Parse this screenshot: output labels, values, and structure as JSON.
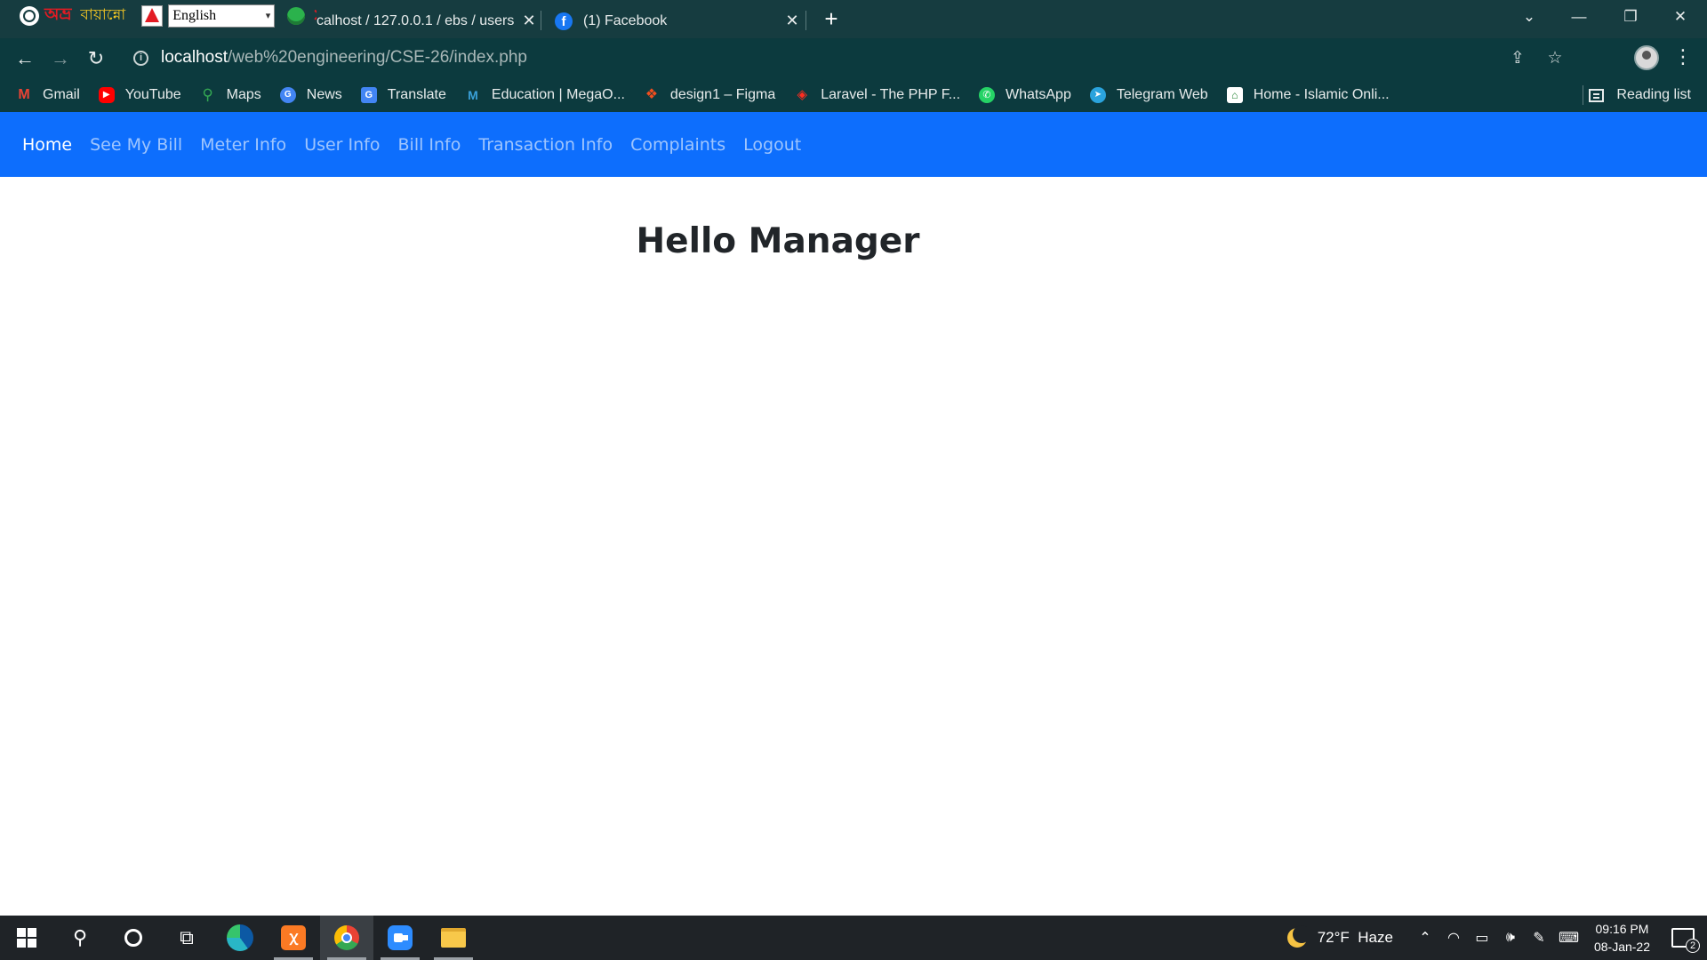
{
  "browser": {
    "avro": {
      "logo": "অভ্র",
      "name": "বায়ান্নো",
      "language": "English"
    },
    "tabs": [
      {
        "title": "calhost / 127.0.0.1 / ebs / users",
        "active": true
      },
      {
        "title": "(1) Facebook",
        "active": false
      }
    ],
    "address": {
      "host": "localhost",
      "path": "/web%20engineering/CSE-26/index.php"
    },
    "bookmarks": [
      {
        "label": "Gmail",
        "icon": "gmail-icon"
      },
      {
        "label": "YouTube",
        "icon": "youtube-icon"
      },
      {
        "label": "Maps",
        "icon": "maps-icon"
      },
      {
        "label": "News",
        "icon": "news-icon"
      },
      {
        "label": "Translate",
        "icon": "translate-icon"
      },
      {
        "label": "Education | MegaO...",
        "icon": "megaoutsource-icon"
      },
      {
        "label": "design1 – Figma",
        "icon": "figma-icon"
      },
      {
        "label": "Laravel - The PHP F...",
        "icon": "laravel-icon"
      },
      {
        "label": "WhatsApp",
        "icon": "whatsapp-icon"
      },
      {
        "label": "Telegram Web",
        "icon": "telegram-icon"
      },
      {
        "label": "Home - Islamic Onli...",
        "icon": "islamic-online-icon"
      }
    ],
    "reading_list": "Reading list"
  },
  "site": {
    "nav": [
      {
        "label": "Home",
        "active": true
      },
      {
        "label": "See My Bill",
        "active": false
      },
      {
        "label": "Meter Info",
        "active": false
      },
      {
        "label": "User Info",
        "active": false
      },
      {
        "label": "Bill Info",
        "active": false
      },
      {
        "label": "Transaction Info",
        "active": false
      },
      {
        "label": "Complaints",
        "active": false
      },
      {
        "label": "Logout",
        "active": false
      }
    ],
    "greeting": "Hello Manager",
    "colors": {
      "navbar": "#0d6efd",
      "browser_frame": "#0c3a3e"
    }
  },
  "taskbar": {
    "weather": {
      "temp": "72°F",
      "condition": "Haze"
    },
    "time": "09:16 PM",
    "date": "08-Jan-22",
    "notifications": "2"
  }
}
